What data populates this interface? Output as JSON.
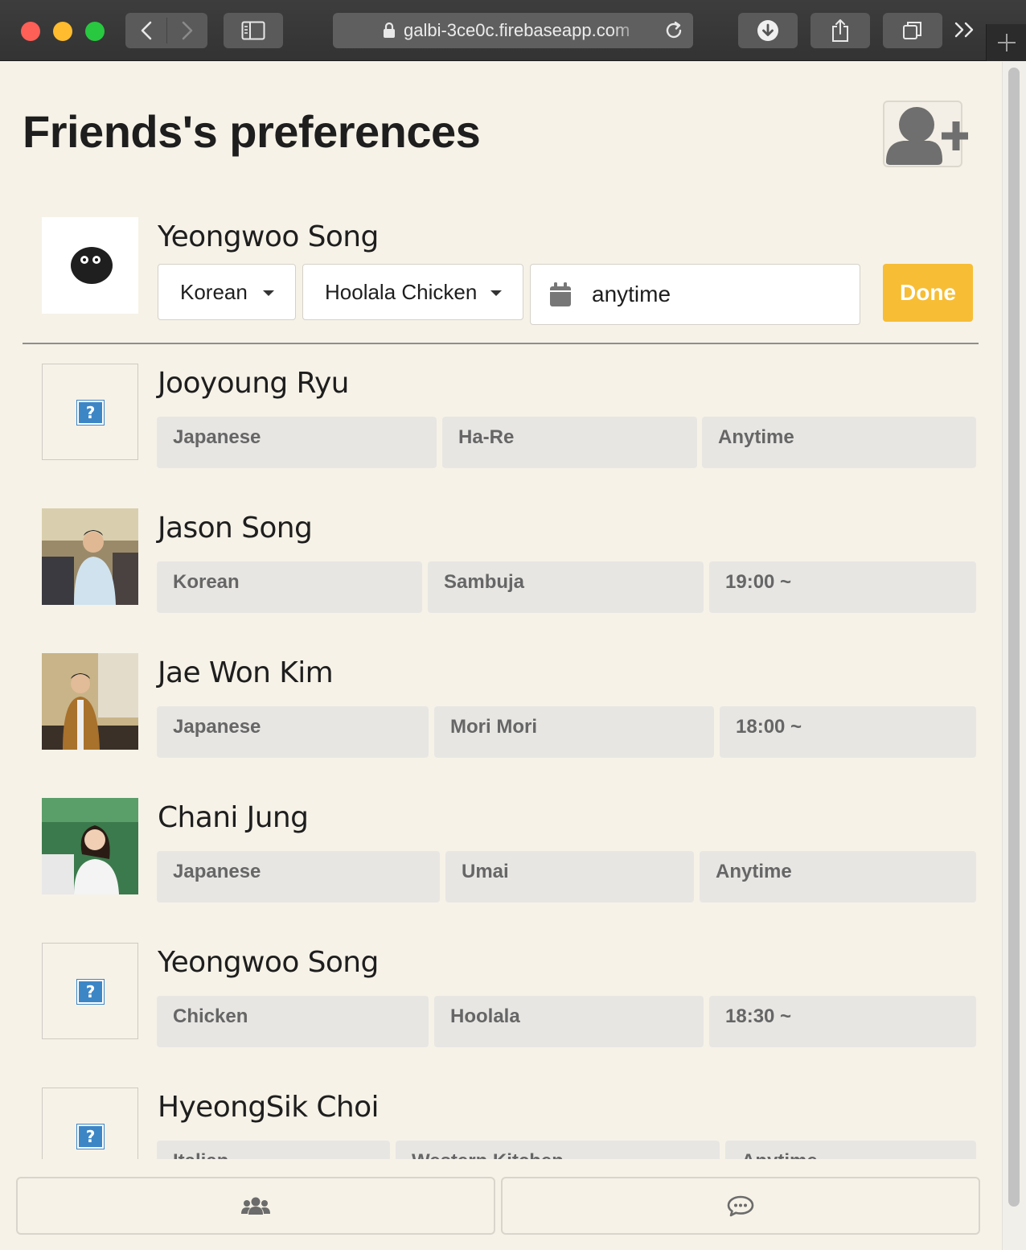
{
  "browser": {
    "url": "galbi-3ce0c.firebaseapp.com",
    "icons": [
      "back-icon",
      "forward-icon",
      "sidebar-icon",
      "lock-icon",
      "reload-icon",
      "download-icon",
      "share-icon",
      "tabs-icon",
      "overflow-icon",
      "new-tab-icon"
    ]
  },
  "page": {
    "title": "Friends's preferences",
    "add_user_icon": "add-user-icon"
  },
  "me": {
    "name": "Yeongwoo Song",
    "cuisine": "Korean",
    "restaurant": "Hoolala Chicken",
    "time": "anytime",
    "done_label": "Done"
  },
  "friends": [
    {
      "name": "Jooyoung Ryu",
      "cuisine": "Japanese",
      "restaurant": "Ha-Re",
      "time": "Anytime"
    },
    {
      "name": "Jason Song",
      "cuisine": "Korean",
      "restaurant": "Sambuja",
      "time": "19:00 ~"
    },
    {
      "name": "Jae Won Kim",
      "cuisine": "Japanese",
      "restaurant": "Mori Mori",
      "time": "18:00 ~"
    },
    {
      "name": "Chani Jung",
      "cuisine": "Japanese",
      "restaurant": "Umai",
      "time": "Anytime"
    },
    {
      "name": "Yeongwoo Song",
      "cuisine": "Chicken",
      "restaurant": "Hoolala",
      "time": "18:30 ~"
    },
    {
      "name": "HyeongSik Choi",
      "cuisine": "Italian",
      "restaurant": "Western Kitchen",
      "time": "Anytime"
    }
  ],
  "bottom_nav": {
    "left_icon": "group-icon",
    "right_icon": "chat-icon"
  },
  "colors": {
    "background": "#f6f2e8",
    "accent": "#f7bd35",
    "chip": "#e7e6e3"
  }
}
